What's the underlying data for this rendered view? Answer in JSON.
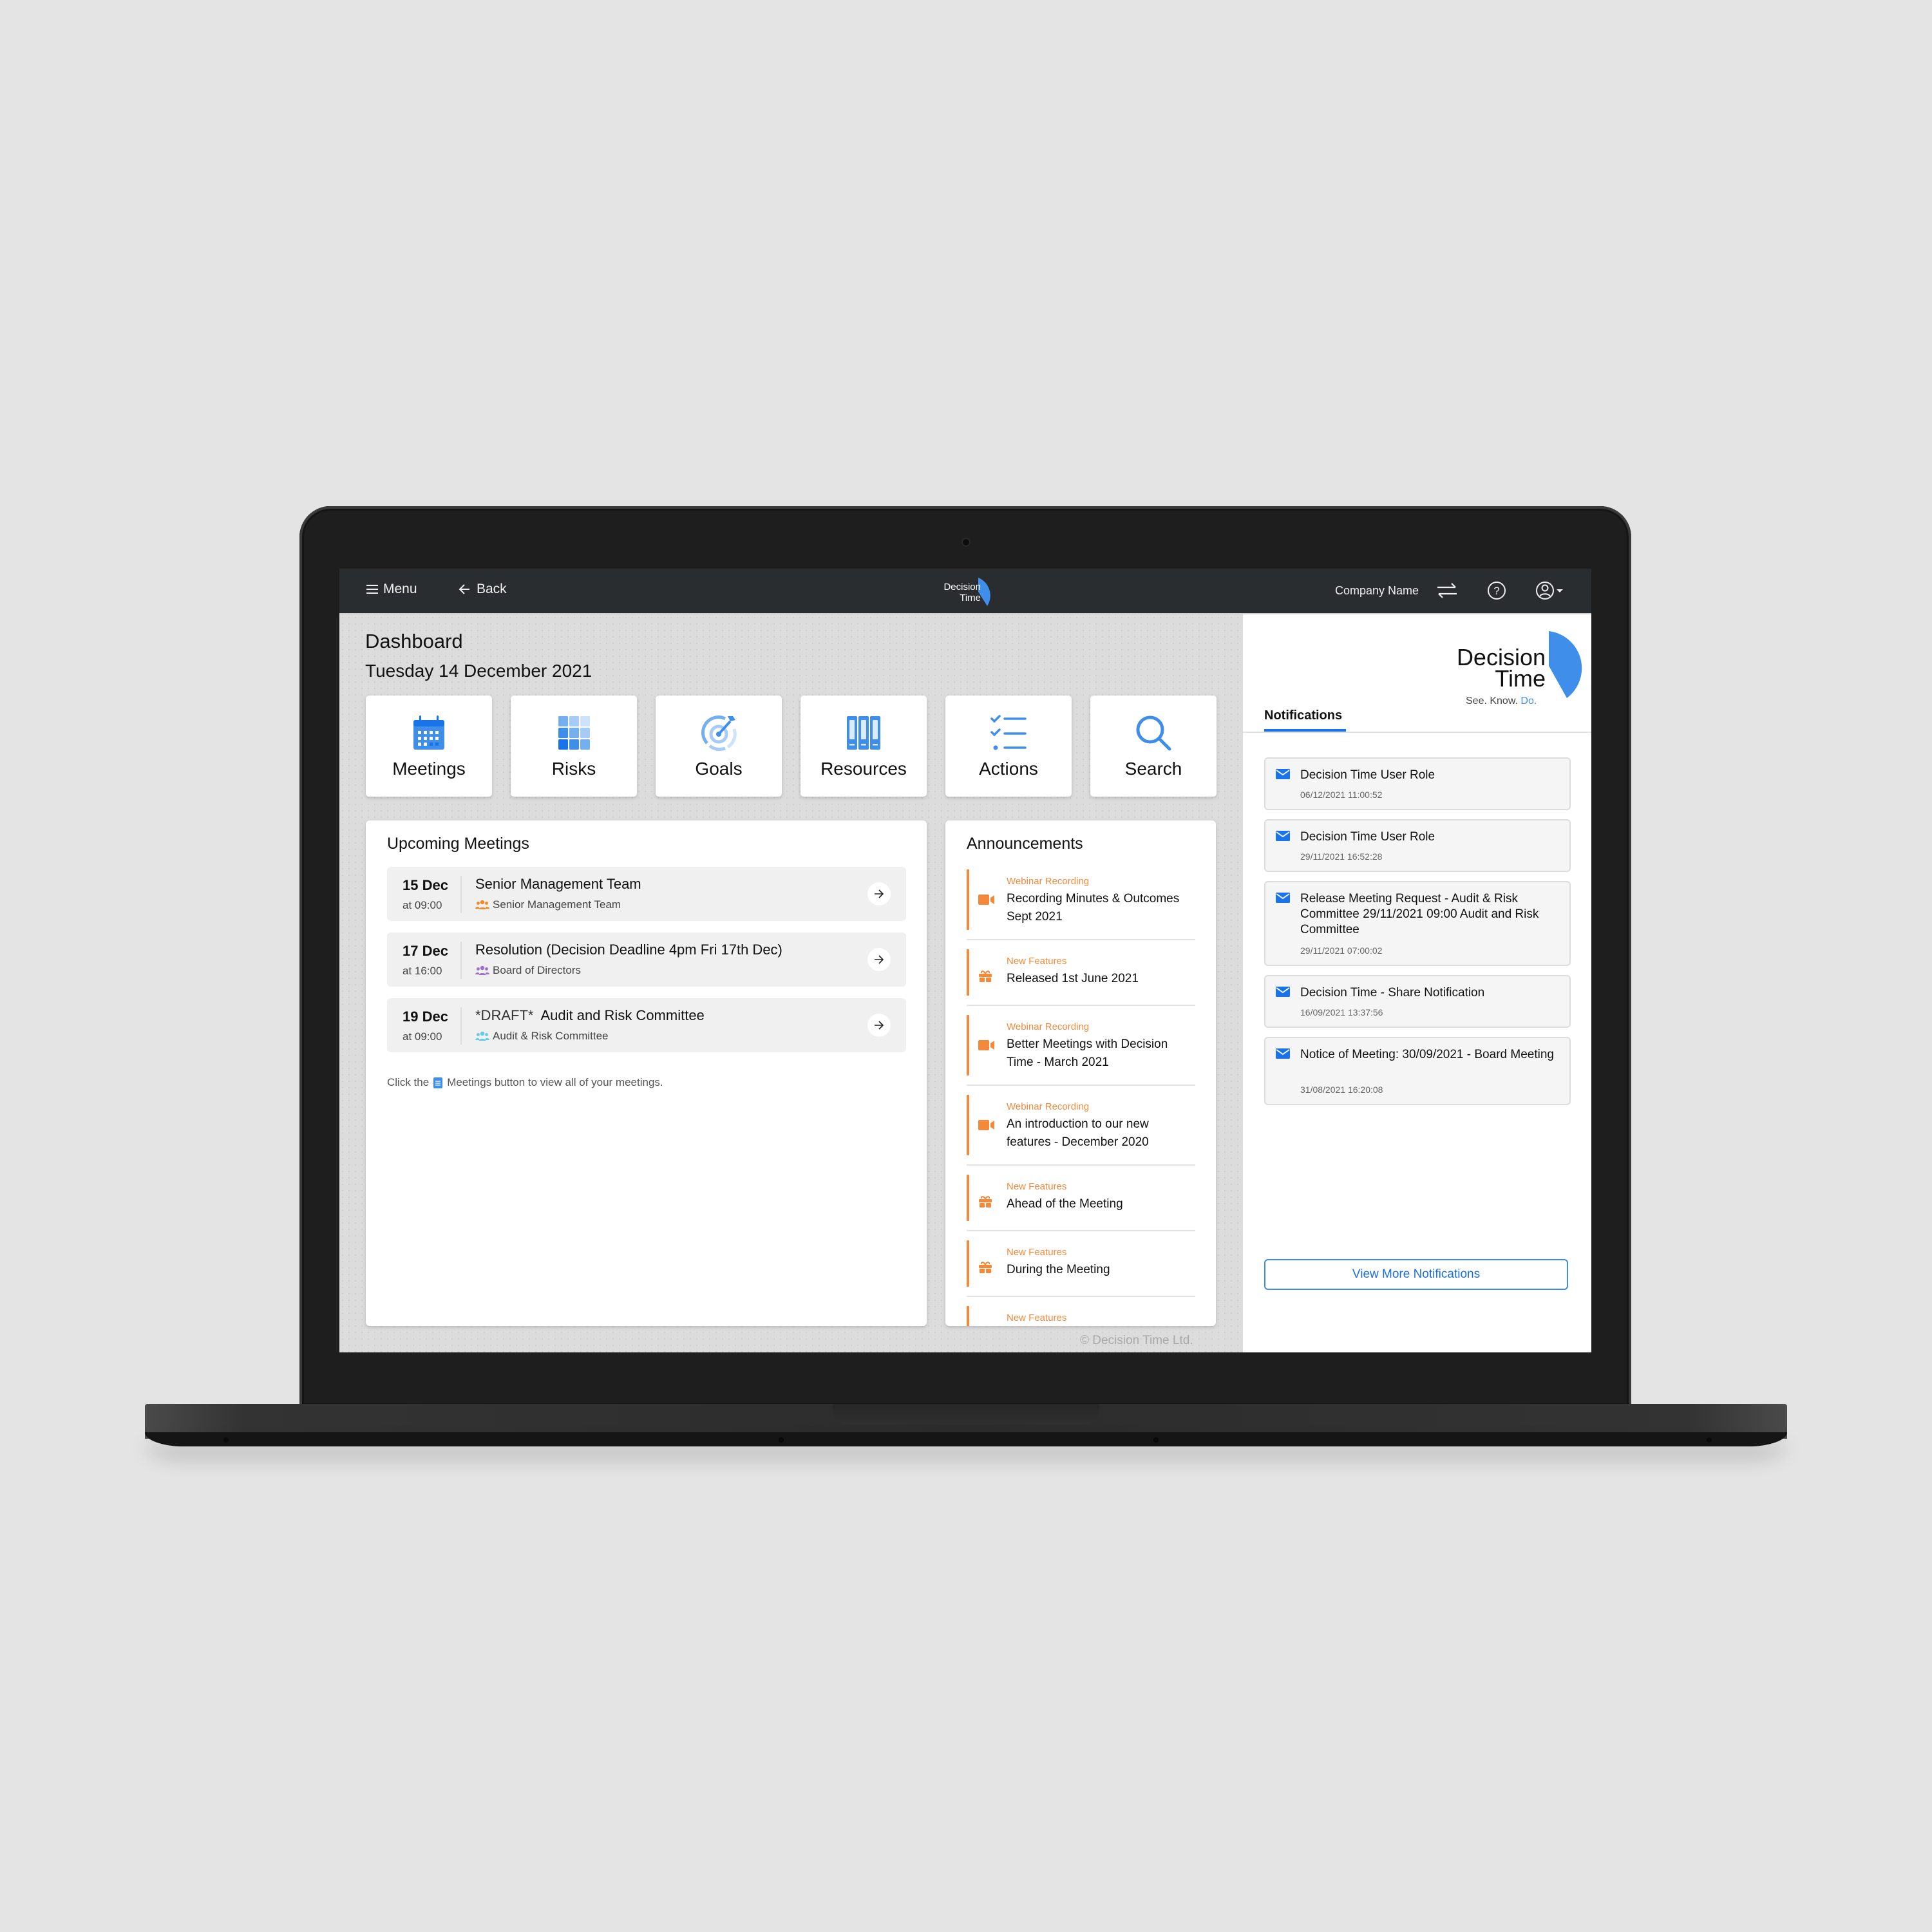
{
  "topbar": {
    "menu_label": "Menu",
    "back_label": "Back",
    "logo_text_line1": "Decision",
    "logo_text_line2": "Time",
    "company_name": "Company Name",
    "icons": [
      "menu-icon",
      "back-arrow-icon",
      "swap-icon",
      "help-icon",
      "user-account-icon",
      "caret-down-icon"
    ]
  },
  "page": {
    "title": "Dashboard",
    "date": "Tuesday 14 December 2021"
  },
  "tiles": [
    {
      "label": "Meetings",
      "icon": "calendar-icon"
    },
    {
      "label": "Risks",
      "icon": "grid-icon"
    },
    {
      "label": "Goals",
      "icon": "target-icon"
    },
    {
      "label": "Resources",
      "icon": "binders-icon"
    },
    {
      "label": "Actions",
      "icon": "checklist-icon"
    },
    {
      "label": "Search",
      "icon": "search-icon"
    }
  ],
  "upcoming": {
    "title": "Upcoming Meetings",
    "meetings": [
      {
        "date": "15 Dec",
        "time": "at 09:00",
        "prefix": "",
        "title": "Senior Management Team",
        "group": "Senior Management Team",
        "group_color": "#f5891f"
      },
      {
        "date": "17 Dec",
        "time": "at 16:00",
        "prefix": "",
        "title": "Resolution (Decision Deadline 4pm Fri 17th Dec)",
        "group": "Board of Directors",
        "group_color": "#9b6fd0"
      },
      {
        "date": "19 Dec",
        "time": "at 09:00",
        "prefix": "*DRAFT*",
        "title": "Audit and Risk Committee",
        "group": "Audit & Risk Committee",
        "group_color": "#62cbe6"
      }
    ],
    "hint_before": "Click the",
    "hint_after": "Meetings button to view all of your meetings."
  },
  "announcements": {
    "title": "Announcements",
    "accent": "#f5893a",
    "items": [
      {
        "category": "Webinar Recording",
        "icon": "video-camera-icon",
        "text": "Recording Minutes & Outcomes Sept 2021"
      },
      {
        "category": "New Features",
        "icon": "gift-icon",
        "text": "Released 1st June 2021"
      },
      {
        "category": "Webinar Recording",
        "icon": "video-camera-icon",
        "text": "Better Meetings with Decision Time - March 2021"
      },
      {
        "category": "Webinar Recording",
        "icon": "video-camera-icon",
        "text": "An introduction to our new features - December 2020"
      },
      {
        "category": "New Features",
        "icon": "gift-icon",
        "text": "Ahead of the Meeting"
      },
      {
        "category": "New Features",
        "icon": "gift-icon",
        "text": "During the Meeting"
      },
      {
        "category": "New Features",
        "icon": "gift-icon",
        "text": ""
      }
    ]
  },
  "footer": {
    "copyright": "© Decision Time Ltd."
  },
  "notifications_panel": {
    "logo_line1": "Decision",
    "logo_line2": "Time",
    "tagline_see_know": "See. Know.",
    "tagline_do": "Do.",
    "tab_label": "Notifications",
    "brand_blue": "#3f8fea",
    "items": [
      {
        "title": "Decision Time User Role",
        "timestamp": "06/12/2021 11:00:52"
      },
      {
        "title": "Decision Time User Role",
        "timestamp": "29/11/2021 16:52:28"
      },
      {
        "title": "Release Meeting Request - Audit & Risk Committee 29/11/2021 09:00 Audit and Risk Committee",
        "timestamp": "29/11/2021 07:00:02"
      },
      {
        "title": "Decision Time - Share Notification",
        "timestamp": "16/09/2021 13:37:56"
      },
      {
        "title": "Notice of Meeting: 30/09/2021 - Board Meeting",
        "timestamp": "31/08/2021 16:20:08"
      }
    ],
    "view_more_label": "View More Notifications"
  }
}
